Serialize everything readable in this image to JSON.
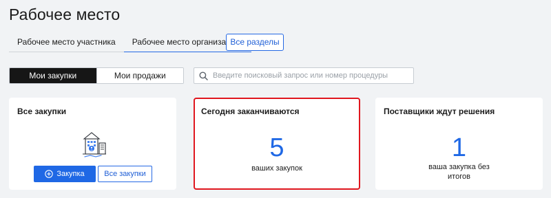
{
  "page": {
    "title": "Рабочее место"
  },
  "tabs": [
    {
      "label": "Рабочее место участника"
    },
    {
      "label": "Рабочее место организатора"
    }
  ],
  "all_sections_label": "Все разделы",
  "segments": [
    {
      "label": "Мои закупки"
    },
    {
      "label": "Мои продажи"
    }
  ],
  "search": {
    "placeholder": "Введите поисковый запрос или номер процедуры",
    "value": ""
  },
  "cards": {
    "all_purchases": {
      "title": "Все закупки",
      "primary_button": "Закупка",
      "secondary_button": "Все закупки"
    },
    "ending_today": {
      "title": "Сегодня заканчиваются",
      "count": "5",
      "caption": "ваших закупок"
    },
    "suppliers_waiting": {
      "title": "Поставщики ждут решения",
      "count": "1",
      "caption": "ваша закупка без итогов"
    }
  },
  "colors": {
    "accent": "#1f68e5",
    "highlight_border": "#e0161e",
    "background": "#f1f3f5",
    "active_segment": "#161616"
  },
  "icons": [
    "search-icon",
    "plus-circle-icon",
    "building-illustration"
  ]
}
